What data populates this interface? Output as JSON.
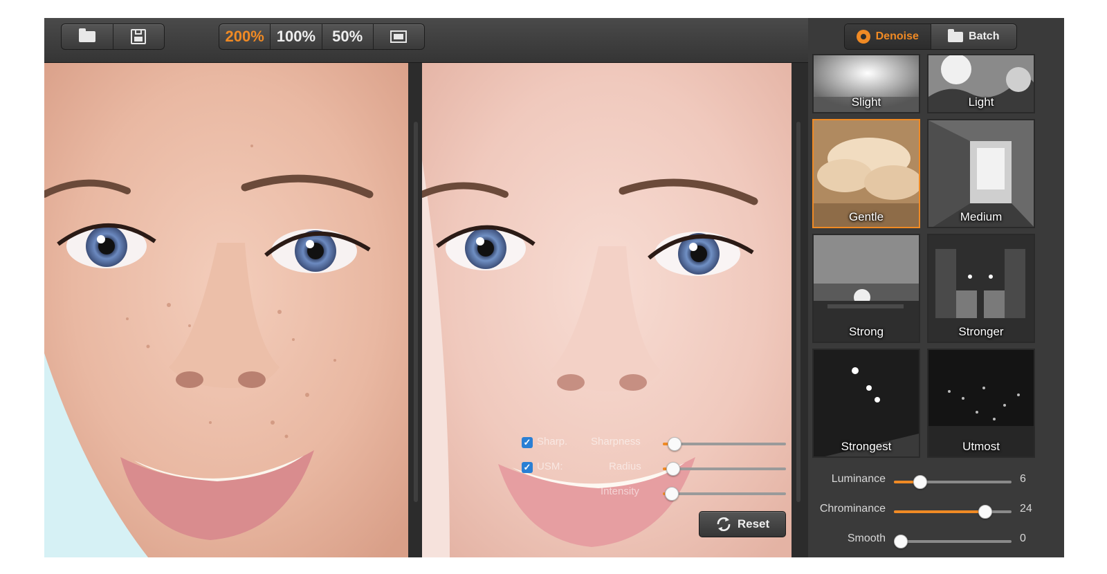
{
  "toolbar": {
    "file_icons": [
      "folder-open-icon",
      "save-icon"
    ],
    "zoom_options": [
      {
        "label": "200%",
        "active": true
      },
      {
        "label": "100%",
        "active": false
      },
      {
        "label": "50%",
        "active": false
      }
    ],
    "fit_icon": "fit-to-screen-icon"
  },
  "mode": {
    "tabs": [
      {
        "label": "Denoise",
        "icon": "gear-icon",
        "active": true
      },
      {
        "label": "Batch",
        "icon": "folder-icon",
        "active": false
      }
    ]
  },
  "presets": [
    {
      "label": "Slight",
      "selected": false
    },
    {
      "label": "Light",
      "selected": false
    },
    {
      "label": "Gentle",
      "selected": true
    },
    {
      "label": "Medium",
      "selected": false
    },
    {
      "label": "Strong",
      "selected": false
    },
    {
      "label": "Stronger",
      "selected": false
    },
    {
      "label": "Strongest",
      "selected": false
    },
    {
      "label": "Utmost",
      "selected": false
    }
  ],
  "controls": [
    {
      "label": "Luminance",
      "value": "6",
      "fraction": 0.22
    },
    {
      "label": "Chrominance",
      "value": "24",
      "fraction": 0.77
    },
    {
      "label": "Smooth",
      "value": "0",
      "fraction": 0.05
    }
  ],
  "overlay": {
    "sharp": {
      "check_label": "Sharp.",
      "slider_label": "Sharpness",
      "checked": true,
      "fraction": 0.09
    },
    "usm": {
      "check_label": "USM:",
      "slider_label": "Radius",
      "checked": true,
      "fraction": 0.08
    },
    "intensity": {
      "slider_label": "Intensity",
      "fraction": 0.07
    }
  },
  "reset_label": "Reset",
  "colors": {
    "accent": "#f08a24",
    "check": "#2a7fd4"
  }
}
